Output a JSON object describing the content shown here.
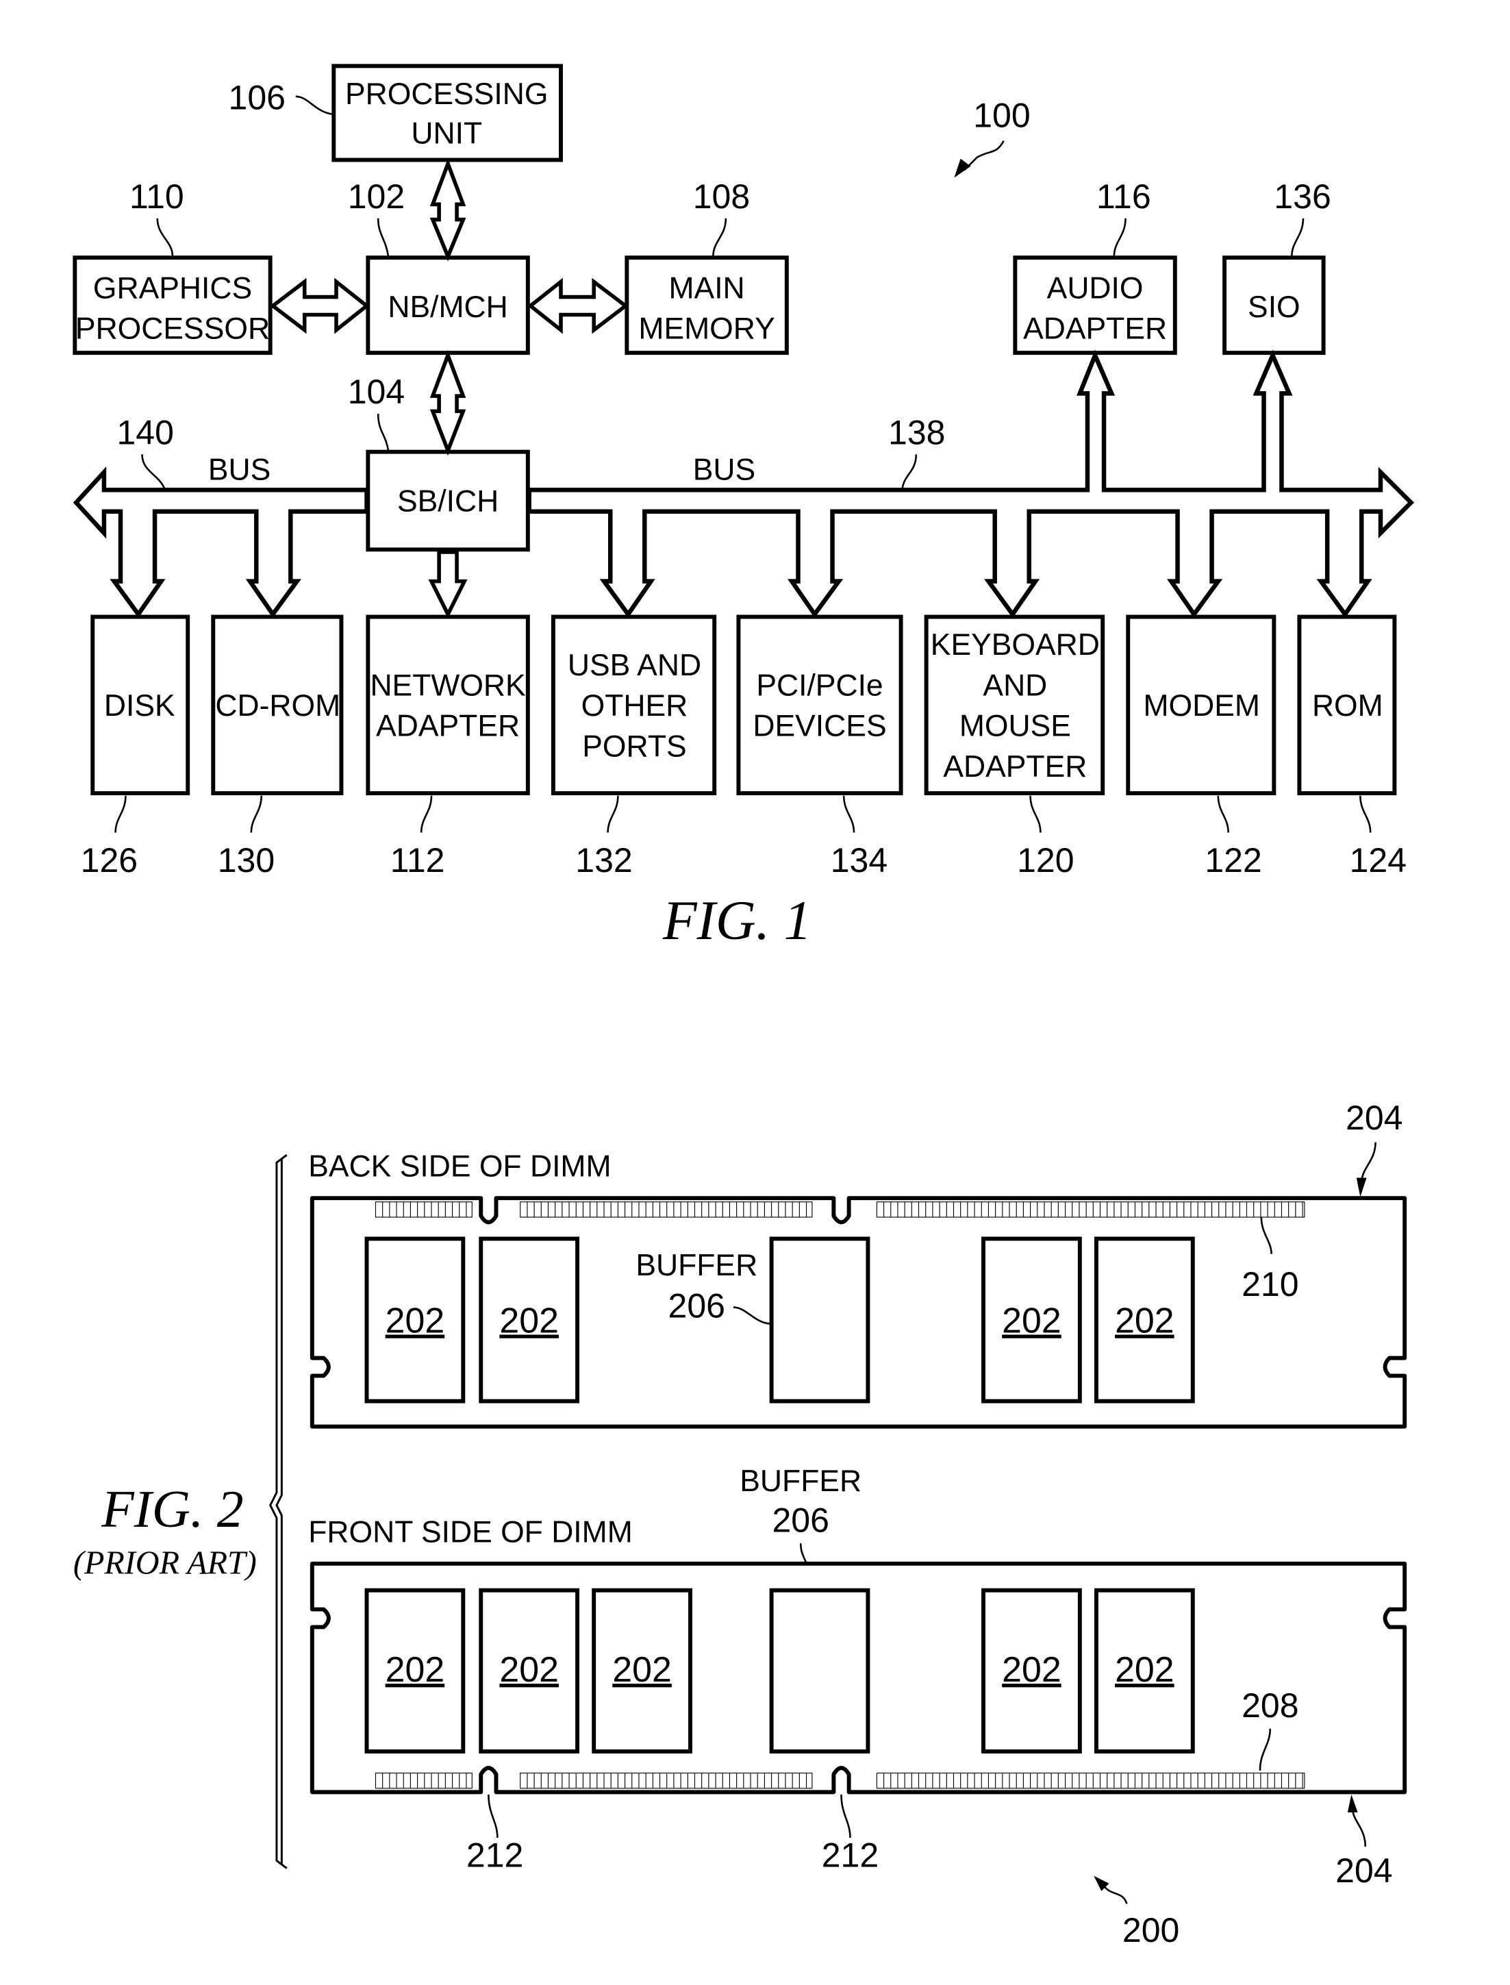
{
  "figure1": {
    "caption": "FIG. 1",
    "system_ref": "100",
    "blocks": {
      "processing_unit": {
        "lines": [
          "PROCESSING",
          "UNIT"
        ],
        "ref": "106"
      },
      "nb_mch": {
        "lines": [
          "NB/MCH"
        ],
        "ref": "102"
      },
      "graphics_processor": {
        "lines": [
          "GRAPHICS",
          "PROCESSOR"
        ],
        "ref": "110"
      },
      "main_memory": {
        "lines": [
          "MAIN",
          "MEMORY"
        ],
        "ref": "108"
      },
      "sb_ich": {
        "lines": [
          "SB/ICH"
        ],
        "ref": "104"
      },
      "audio_adapter": {
        "lines": [
          "AUDIO",
          "ADAPTER"
        ],
        "ref": "116"
      },
      "sio": {
        "lines": [
          "SIO"
        ],
        "ref": "136"
      },
      "disk": {
        "lines": [
          "DISK"
        ],
        "ref": "126"
      },
      "cd_rom": {
        "lines": [
          "CD-ROM"
        ],
        "ref": "130"
      },
      "network_adapter": {
        "lines": [
          "NETWORK",
          "ADAPTER"
        ],
        "ref": "112"
      },
      "usb_ports": {
        "lines": [
          "USB AND",
          "OTHER",
          "PORTS"
        ],
        "ref": "132"
      },
      "pci_devices": {
        "lines": [
          "PCI/PCIe",
          "DEVICES"
        ],
        "ref": "134"
      },
      "keyboard_mouse": {
        "lines": [
          "KEYBOARD",
          "AND",
          "MOUSE",
          "ADAPTER"
        ],
        "ref": "120"
      },
      "modem": {
        "lines": [
          "MODEM"
        ],
        "ref": "122"
      },
      "rom": {
        "lines": [
          "ROM"
        ],
        "ref": "124"
      }
    },
    "buses": {
      "left": {
        "label": "BUS",
        "ref": "140"
      },
      "right": {
        "label": "BUS",
        "ref": "138"
      }
    }
  },
  "figure2": {
    "caption": "FIG. 2",
    "subcaption": "(PRIOR ART)",
    "assembly_ref": "200",
    "back": {
      "title": "BACK SIDE OF DIMM",
      "dimm_ref": "204",
      "pads_ref": "210",
      "buffer_label": "BUFFER",
      "buffer_ref": "206",
      "chip_labels": [
        "202",
        "202",
        "202",
        "202"
      ]
    },
    "front": {
      "title": "FRONT SIDE OF DIMM",
      "dimm_ref": "204",
      "pads_ref": "208",
      "buffer_label": "BUFFER",
      "buffer_ref": "206",
      "notch_refs": [
        "212",
        "212"
      ],
      "chip_labels": [
        "202",
        "202",
        "202",
        "202",
        "202"
      ]
    }
  }
}
